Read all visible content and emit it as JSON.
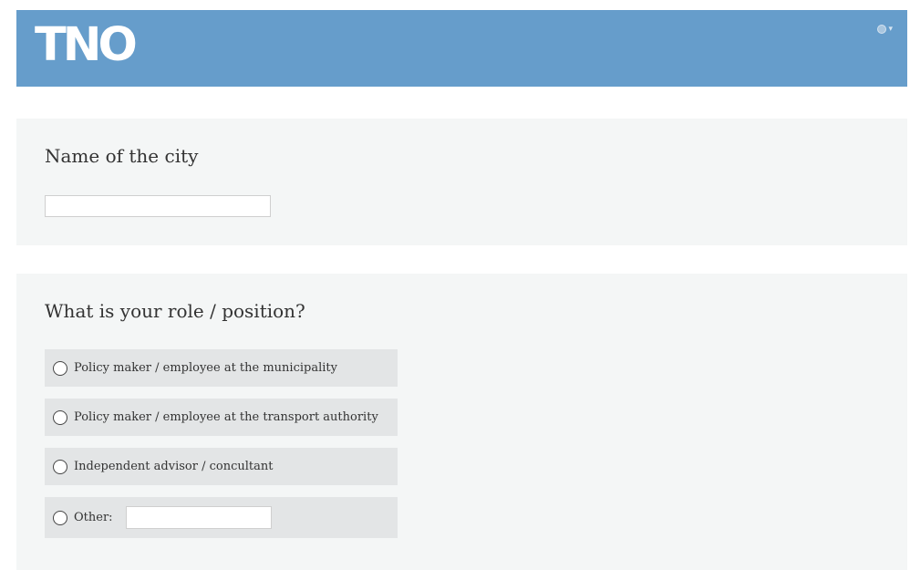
{
  "header": {
    "logo_text": "TNO",
    "language_icon": "globe-icon",
    "language_caret": "▾"
  },
  "question_city": {
    "title": "Name of the city",
    "value": ""
  },
  "question_role": {
    "title": "What is your role / position?",
    "options": [
      {
        "label": "Policy maker / employee at the municipality",
        "selected": false
      },
      {
        "label": "Policy maker /  employee at the transport authority",
        "selected": false
      },
      {
        "label": "Independent advisor / concultant",
        "selected": false
      },
      {
        "label": "Other:",
        "selected": false,
        "other_value": ""
      }
    ]
  },
  "colors": {
    "header_bg": "#669dcb",
    "section_bg": "#f4f6f6",
    "option_bg": "#e3e5e6"
  }
}
